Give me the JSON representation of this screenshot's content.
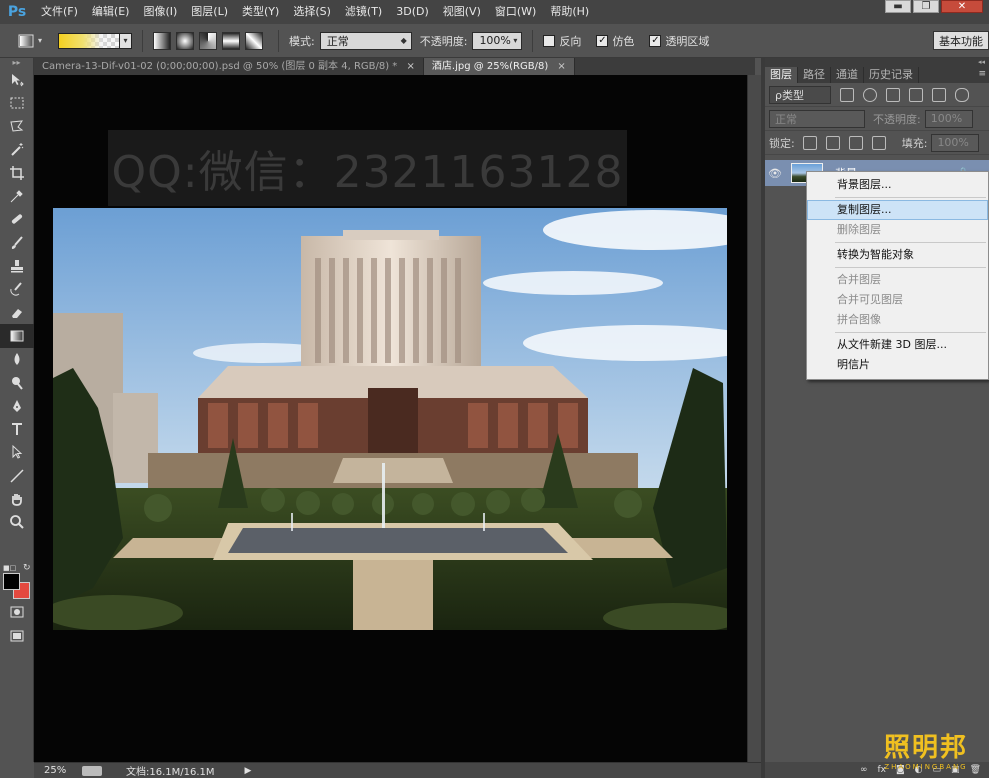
{
  "app": {
    "logo": "Ps"
  },
  "menu": {
    "items": [
      "文件(F)",
      "编辑(E)",
      "图像(I)",
      "图层(L)",
      "类型(Y)",
      "选择(S)",
      "滤镜(T)",
      "3D(D)",
      "视图(V)",
      "窗口(W)",
      "帮助(H)"
    ],
    "window_buttons": {
      "minimize": "▬",
      "restore": "❐",
      "close": "✕"
    }
  },
  "options": {
    "mode_label": "模式:",
    "mode_value": "正常",
    "opacity_label": "不透明度:",
    "opacity_value": "100%",
    "reverse_label": "反向",
    "reverse_checked": false,
    "dither_label": "仿色",
    "dither_checked": true,
    "transparency_label": "透明区域",
    "transparency_checked": true,
    "workspace_button": "基本功能"
  },
  "tabs": [
    {
      "label": "Camera-13-Dif-v01-02 (0;00;00;00).psd @ 50% (图层 0 副本 4, RGB/8) *",
      "close": "×",
      "active": false
    },
    {
      "label": "酒店.jpg @ 25%(RGB/8)",
      "close": "×",
      "active": true
    }
  ],
  "canvas": {
    "watermark": "QQ:微信：2321163128"
  },
  "status": {
    "zoom": "25%",
    "doc_size": "文档:16.1M/16.1M",
    "arrow": "▶"
  },
  "panel": {
    "tabs": [
      "图层",
      "路径",
      "通道",
      "历史记录"
    ],
    "filter_label": "ρ类型",
    "blend_mode": "正常",
    "opacity_label": "不透明度:",
    "opacity_value": "100%",
    "lock_label": "锁定:",
    "fill_label": "填充:",
    "fill_value": "100%",
    "layer_name": "背景",
    "eye": "👁",
    "lock_icon": "🔒",
    "footer": [
      "∞",
      "fx",
      "◙",
      "◐",
      "▭",
      "▣",
      "🗑"
    ]
  },
  "context_menu": {
    "groups": [
      [
        {
          "label": "背景图层...",
          "disabled": false,
          "hover": false
        }
      ],
      [
        {
          "label": "复制图层...",
          "disabled": false,
          "hover": true
        },
        {
          "label": "删除图层",
          "disabled": true,
          "hover": false
        }
      ],
      [
        {
          "label": "转换为智能对象",
          "disabled": false,
          "hover": false
        }
      ],
      [
        {
          "label": "合并图层",
          "disabled": true,
          "hover": false
        },
        {
          "label": "合并可见图层",
          "disabled": true,
          "hover": false
        },
        {
          "label": "拼合图像",
          "disabled": true,
          "hover": false
        }
      ],
      [
        {
          "label": "从文件新建 3D 图层...",
          "disabled": false,
          "hover": false
        },
        {
          "label": "明信片",
          "disabled": false,
          "hover": false
        }
      ]
    ]
  },
  "brand": {
    "cn": "照明邦",
    "en": "ZHAOMINGBANG"
  },
  "colors": {
    "foreground": "#000000",
    "background": "#e4493f",
    "accent": "#7a8fb0"
  }
}
